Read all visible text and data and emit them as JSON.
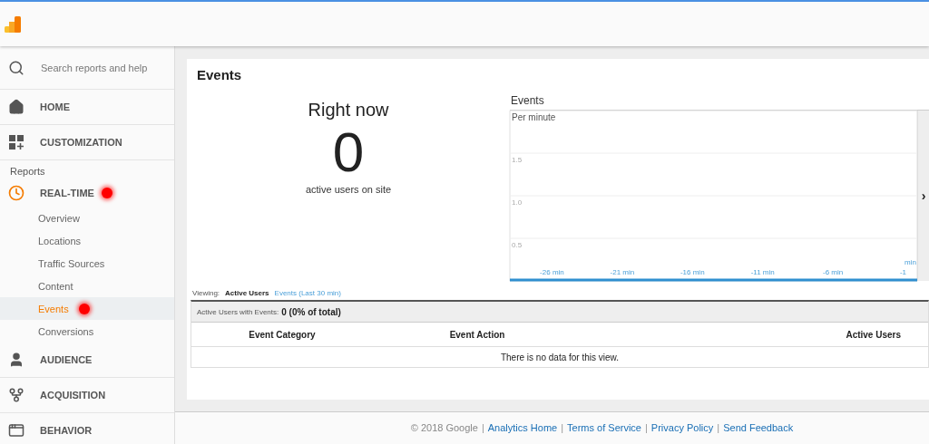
{
  "search": {
    "placeholder": "Search reports and help"
  },
  "nav": [
    {
      "kind": "main",
      "label": "HOME",
      "active": false
    },
    {
      "kind": "main",
      "label": "CUSTOMIZATION",
      "active": false
    },
    {
      "kind": "section",
      "label": "Reports"
    },
    {
      "kind": "main",
      "label": "REAL-TIME",
      "active": true,
      "annotated": true,
      "children": [
        {
          "label": "Overview",
          "selected": false
        },
        {
          "label": "Locations",
          "selected": false
        },
        {
          "label": "Traffic Sources",
          "selected": false
        },
        {
          "label": "Content",
          "selected": false
        },
        {
          "label": "Events",
          "selected": true,
          "annotated": true
        },
        {
          "label": "Conversions",
          "selected": false
        }
      ]
    },
    {
      "kind": "main",
      "label": "AUDIENCE",
      "active": false
    },
    {
      "kind": "main",
      "label": "ACQUISITION",
      "active": false
    },
    {
      "kind": "main",
      "label": "BEHAVIOR",
      "active": false
    }
  ],
  "page": {
    "title": "Events"
  },
  "right_now": {
    "title": "Right now",
    "count": "0",
    "caption": "active users on site"
  },
  "chart": {
    "unit_label": "min",
    "chart_data": {
      "type": "line",
      "title": "Events",
      "ylabel": "Per minute",
      "xlim": [
        -29,
        0
      ],
      "ylim": [
        0,
        2
      ],
      "grid": true,
      "yticks": [
        {
          "value": 0.5,
          "label": "0.5"
        },
        {
          "value": 1.0,
          "label": "1.0"
        },
        {
          "value": 1.5,
          "label": "1.5"
        }
      ],
      "xticks": [
        {
          "value": -26,
          "label": "-26 min"
        },
        {
          "value": -21,
          "label": "-21 min"
        },
        {
          "value": -16,
          "label": "-16 min"
        },
        {
          "value": -11,
          "label": "-11 min"
        },
        {
          "value": -6,
          "label": "-6 min"
        },
        {
          "value": -1,
          "label": "-1"
        }
      ]
    },
    "next_arrow": "›"
  },
  "viewing": {
    "label": "Viewing:",
    "tabs": [
      {
        "label": "Active Users",
        "selected": true
      },
      {
        "label": "Events (Last 30 min)",
        "selected": false
      }
    ]
  },
  "summary": {
    "label": "Active Users with Events:",
    "value": "0 (0% of total)"
  },
  "table": {
    "columns": [
      {
        "label": "Event Category"
      },
      {
        "label": "Event Action"
      },
      {
        "label": "Active Users"
      }
    ],
    "empty": "There is no data for this view."
  },
  "footer": [
    {
      "kind": "text",
      "label": "© 2018 Google"
    },
    {
      "kind": "separator",
      "label": "|"
    },
    {
      "kind": "link",
      "label": "Analytics Home"
    },
    {
      "kind": "separator",
      "label": "|"
    },
    {
      "kind": "link",
      "label": "Terms of Service"
    },
    {
      "kind": "separator",
      "label": "|"
    },
    {
      "kind": "link",
      "label": "Privacy Policy"
    },
    {
      "kind": "separator",
      "label": "|"
    },
    {
      "kind": "link",
      "label": "Send Feedback"
    }
  ]
}
